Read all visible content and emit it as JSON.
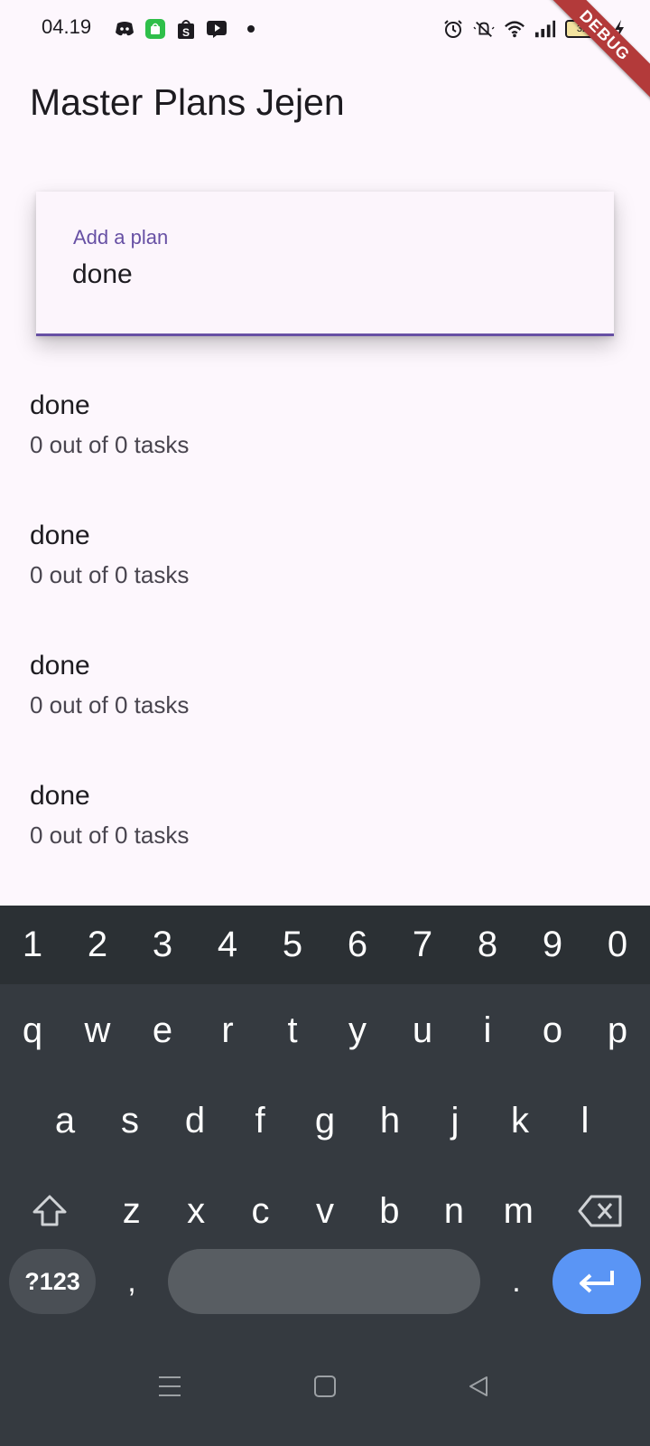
{
  "status_bar": {
    "time": "04.19",
    "battery_level": "32",
    "left_icons": [
      "discord-icon",
      "app-store-icon",
      "shopee-icon",
      "youtube-icon",
      "notification-dot-icon"
    ],
    "right_icons": [
      "alarm-icon",
      "mute-icon",
      "wifi-icon",
      "signal-icon",
      "battery-icon",
      "charging-icon"
    ],
    "debug_banner": "DEBUG"
  },
  "app_bar": {
    "title": "Master Plans Jejen"
  },
  "plan_input": {
    "label": "Add a plan",
    "value": "done"
  },
  "plans": [
    {
      "title": "done",
      "subtitle": "0 out of 0 tasks"
    },
    {
      "title": "done",
      "subtitle": "0 out of 0 tasks"
    },
    {
      "title": "done",
      "subtitle": "0 out of 0 tasks"
    },
    {
      "title": "done",
      "subtitle": "0 out of 0 tasks"
    }
  ],
  "keyboard": {
    "numbers": [
      "1",
      "2",
      "3",
      "4",
      "5",
      "6",
      "7",
      "8",
      "9",
      "0"
    ],
    "row1": [
      "q",
      "w",
      "e",
      "r",
      "t",
      "y",
      "u",
      "i",
      "o",
      "p"
    ],
    "row2": [
      "a",
      "s",
      "d",
      "f",
      "g",
      "h",
      "j",
      "k",
      "l"
    ],
    "row3": [
      "z",
      "x",
      "c",
      "v",
      "b",
      "n",
      "m"
    ],
    "symbols_key": "?123",
    "comma_key": ",",
    "period_key": "."
  },
  "colors": {
    "accent": "#6750a4",
    "background": "#fdf7fd",
    "keyboard": "#353a40",
    "enter_key": "#5a95f5",
    "debug_ribbon": "#b33a3a"
  }
}
